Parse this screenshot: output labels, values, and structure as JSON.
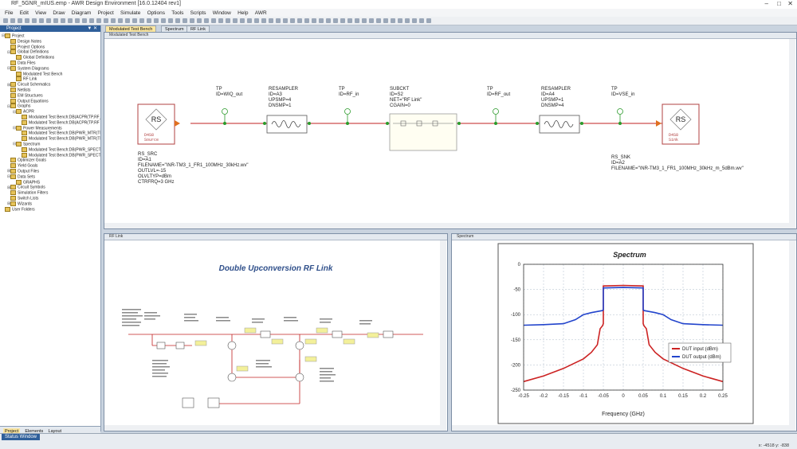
{
  "app": {
    "title": "RF_5GNR_mIUS.emp - AWR Design Environment [16.0.12404 rev1]",
    "menu": [
      "File",
      "Edit",
      "View",
      "Draw",
      "Diagram",
      "Project",
      "Simulate",
      "Options",
      "Tools",
      "Scripts",
      "Window",
      "Help",
      "AWR"
    ],
    "window_controls": [
      "–",
      "□",
      "✕"
    ]
  },
  "sidebar": {
    "title": "Project",
    "pin": "▼ ✕",
    "items": [
      {
        "label": "Project",
        "level": 0,
        "toggle": "⊟"
      },
      {
        "label": "Design Notes",
        "level": 1,
        "toggle": ""
      },
      {
        "label": "Project Options",
        "level": 1,
        "toggle": ""
      },
      {
        "label": "Global Definitions",
        "level": 1,
        "toggle": "⊟"
      },
      {
        "label": "Global Definitions",
        "level": 2,
        "toggle": ""
      },
      {
        "label": "Data Files",
        "level": 1,
        "toggle": ""
      },
      {
        "label": "System Diagrams",
        "level": 1,
        "toggle": "⊟"
      },
      {
        "label": "Modulated Test Bench",
        "level": 2,
        "toggle": ""
      },
      {
        "label": "RF Link",
        "level": 2,
        "toggle": ""
      },
      {
        "label": "Circuit Schematics",
        "level": 1,
        "toggle": "⊞"
      },
      {
        "label": "Netlists",
        "level": 1,
        "toggle": ""
      },
      {
        "label": "EM Structures",
        "level": 1,
        "toggle": ""
      },
      {
        "label": "Output Equations",
        "level": 1,
        "toggle": ""
      },
      {
        "label": "Graphs",
        "level": 1,
        "toggle": "⊟"
      },
      {
        "label": "ACPR",
        "level": 2,
        "toggle": "⊟"
      },
      {
        "label": "Modulated Test Bench:DB(ACPR(TP.RF_",
        "level": 3,
        "toggle": ""
      },
      {
        "label": "Modulated Test Bench:DB(ACPR(TP.RF",
        "level": 3,
        "toggle": ""
      },
      {
        "label": "Power Measurements",
        "level": 2,
        "toggle": "⊟"
      },
      {
        "label": "Modulated Test Bench:DB(PWR_MTR(TP",
        "level": 3,
        "toggle": ""
      },
      {
        "label": "Modulated Test Bench:DB(PWR_MTR(TP",
        "level": 3,
        "toggle": ""
      },
      {
        "label": "Spectrum",
        "level": 2,
        "toggle": "⊟"
      },
      {
        "label": "Modulated Test Bench:DB(PWR_SPECT",
        "level": 3,
        "toggle": ""
      },
      {
        "label": "Modulated Test Bench:DB(PWR_SPECT",
        "level": 3,
        "toggle": ""
      },
      {
        "label": "Optimizer Goals",
        "level": 1,
        "toggle": ""
      },
      {
        "label": "Yield Goals",
        "level": 1,
        "toggle": ""
      },
      {
        "label": "Output Files",
        "level": 1,
        "toggle": "⊞"
      },
      {
        "label": "Data Sets",
        "level": 1,
        "toggle": "⊟"
      },
      {
        "label": "GRAPHS",
        "level": 2,
        "toggle": ""
      },
      {
        "label": "Circuit Symbols",
        "level": 1,
        "toggle": "⊞"
      },
      {
        "label": "Simulation Filters",
        "level": 1,
        "toggle": ""
      },
      {
        "label": "Switch Lists",
        "level": 1,
        "toggle": ""
      },
      {
        "label": "Wizards",
        "level": 1,
        "toggle": "⊞"
      },
      {
        "label": "User Folders",
        "level": 0,
        "toggle": ""
      }
    ],
    "tabs": [
      "Project",
      "Elements",
      "Layout"
    ]
  },
  "doc_tabs": [
    {
      "label": "Modulated Test Bench",
      "active": true
    },
    {
      "label": "Spectrum",
      "active": false
    },
    {
      "label": "RF Link",
      "active": false
    }
  ],
  "bench": {
    "title": "Modulated Test Bench",
    "src": {
      "icon_text": "RS",
      "block": [
        "D4S8",
        "Source"
      ],
      "lines": [
        "RS_SRC",
        "ID=A1",
        "FILENAME=\"\\NR-TM3_1_FR1_100MHz_30kHz.wv\"",
        "OUTLVL=-15",
        "OLVLTYP=dBm",
        "CTRFRQ=3 GHz"
      ]
    },
    "tp1": [
      "TP",
      "ID=WIQ_out"
    ],
    "res1": [
      "RESAMPLER",
      "ID=A3",
      "UPSMP=4",
      "DNSMP=1"
    ],
    "tp2": [
      "TP",
      "ID=RF_in"
    ],
    "subckt": [
      "SUBCKT",
      "ID=S2",
      "NET=\"RF Link\"",
      "CGAIN=0"
    ],
    "tp3": [
      "TP",
      "ID=RF_out"
    ],
    "res2": [
      "RESAMPLER",
      "ID=A4",
      "UPSMP=1",
      "DNSMP=4"
    ],
    "tp4": [
      "TP",
      "ID=VSE_in"
    ],
    "snk": {
      "icon_text": "RS",
      "block": [
        "D4S8",
        "Sink"
      ],
      "lines": [
        "RS_SNK",
        "ID=A2",
        "FILENAME=\"\\NR-TM3_1_FR1_100MHz_30kHz_m_5dBm.wv\""
      ]
    }
  },
  "rflink": {
    "title": "RF Link",
    "heading": "Double Upconversion RF Link"
  },
  "spectrum_window": {
    "title": "Spectrum"
  },
  "chart_data": {
    "type": "line",
    "title": "Spectrum",
    "xlabel": "Frequency (GHz)",
    "ylabel": "",
    "xlim": [
      -0.25,
      0.25
    ],
    "ylim": [
      -250,
      0
    ],
    "xticks": [
      -0.25,
      -0.2,
      -0.15,
      -0.1,
      -0.05,
      0,
      0.05,
      0.1,
      0.15,
      0.2,
      0.25
    ],
    "xtick_labels": [
      "-0.25",
      "-0.2",
      "-0.15",
      "-0.1",
      "-0.05",
      "0",
      "0.05",
      "0.1",
      "0.15",
      "0.2",
      "0.25"
    ],
    "yticks": [
      0,
      -50,
      -100,
      -150,
      -200,
      -250
    ],
    "ytick_labels": [
      "0",
      "-50",
      "-100",
      "-150",
      "-200",
      "-250"
    ],
    "grid": true,
    "legend": "bottom-right",
    "series": [
      {
        "name": "DUT input (dBm)",
        "color": "#cc2222",
        "x": [
          -0.25,
          -0.2,
          -0.15,
          -0.1,
          -0.08,
          -0.065,
          -0.058,
          -0.052,
          -0.05,
          -0.05,
          0,
          0.05,
          0.05,
          0.052,
          0.058,
          0.065,
          0.08,
          0.1,
          0.15,
          0.2,
          0.25
        ],
        "y": [
          -233,
          -222,
          -207,
          -188,
          -175,
          -160,
          -128,
          -122,
          -118,
          -43,
          -42,
          -43,
          -118,
          -122,
          -128,
          -160,
          -175,
          -188,
          -207,
          -222,
          -233
        ]
      },
      {
        "name": "DUT output (dBm)",
        "color": "#2244cc",
        "x": [
          -0.25,
          -0.2,
          -0.15,
          -0.12,
          -0.1,
          -0.08,
          -0.06,
          -0.052,
          -0.05,
          -0.05,
          0,
          0.05,
          0.05,
          0.052,
          0.06,
          0.08,
          0.1,
          0.12,
          0.15,
          0.2,
          0.25
        ],
        "y": [
          -121,
          -120,
          -118,
          -110,
          -100,
          -96,
          -93,
          -92,
          -90,
          -47,
          -46,
          -47,
          -90,
          -92,
          -93,
          -96,
          -100,
          -110,
          -118,
          -120,
          -121
        ]
      }
    ]
  },
  "status": {
    "tab": "Status Window",
    "coords": "x: -4518   y: -838"
  }
}
